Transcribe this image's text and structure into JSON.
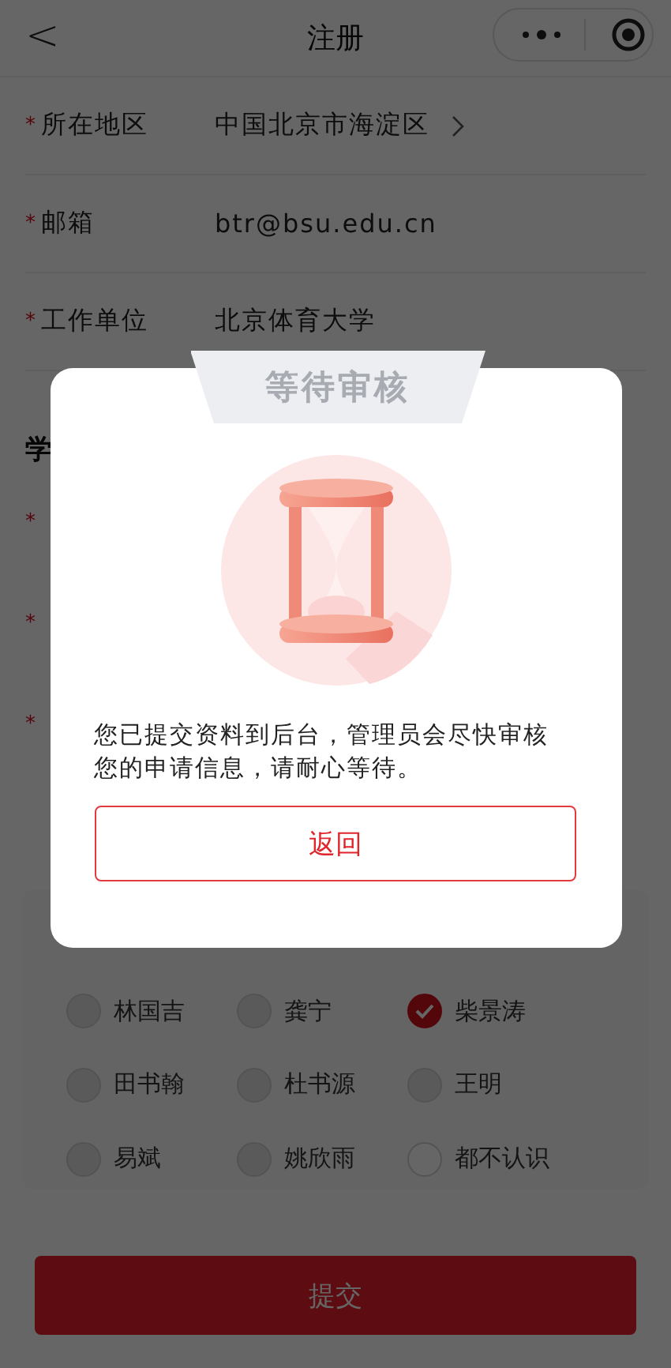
{
  "nav": {
    "back": "<",
    "title": "注册"
  },
  "fields": [
    {
      "marker": "*",
      "label": "所在地区",
      "value": "中国北京市海淀区",
      "chevron": true
    },
    {
      "marker": "*",
      "label": "邮箱",
      "value": "btr@bsu.edu.cn",
      "chevron": false
    },
    {
      "marker": "*",
      "label": "工作单位",
      "value": "北京体育大学",
      "chevron": false
    }
  ],
  "section": {
    "title": "学",
    "rows": [
      {
        "marker": "*"
      },
      {
        "marker": "*"
      },
      {
        "marker": "*"
      }
    ]
  },
  "acquaintances": [
    {
      "name": "林国吉",
      "kind": "person",
      "selected": false
    },
    {
      "name": "龚宁",
      "kind": "person",
      "selected": false
    },
    {
      "name": "柴景涛",
      "kind": "person",
      "selected": true
    },
    {
      "name": "田书翰",
      "kind": "person",
      "selected": false
    },
    {
      "name": "杜书源",
      "kind": "person",
      "selected": false
    },
    {
      "name": "王明",
      "kind": "person",
      "selected": false
    },
    {
      "name": "易斌",
      "kind": "person",
      "selected": false
    },
    {
      "name": "姚欣雨",
      "kind": "person",
      "selected": false
    },
    {
      "name": "都不认识",
      "kind": "none",
      "selected": false
    }
  ],
  "submit": "提交",
  "dialog": {
    "title": "等待审核",
    "message": "您已提交资料到后台，管理员会尽快审核您的申请信息，请耐心等待。",
    "button": "返回"
  }
}
